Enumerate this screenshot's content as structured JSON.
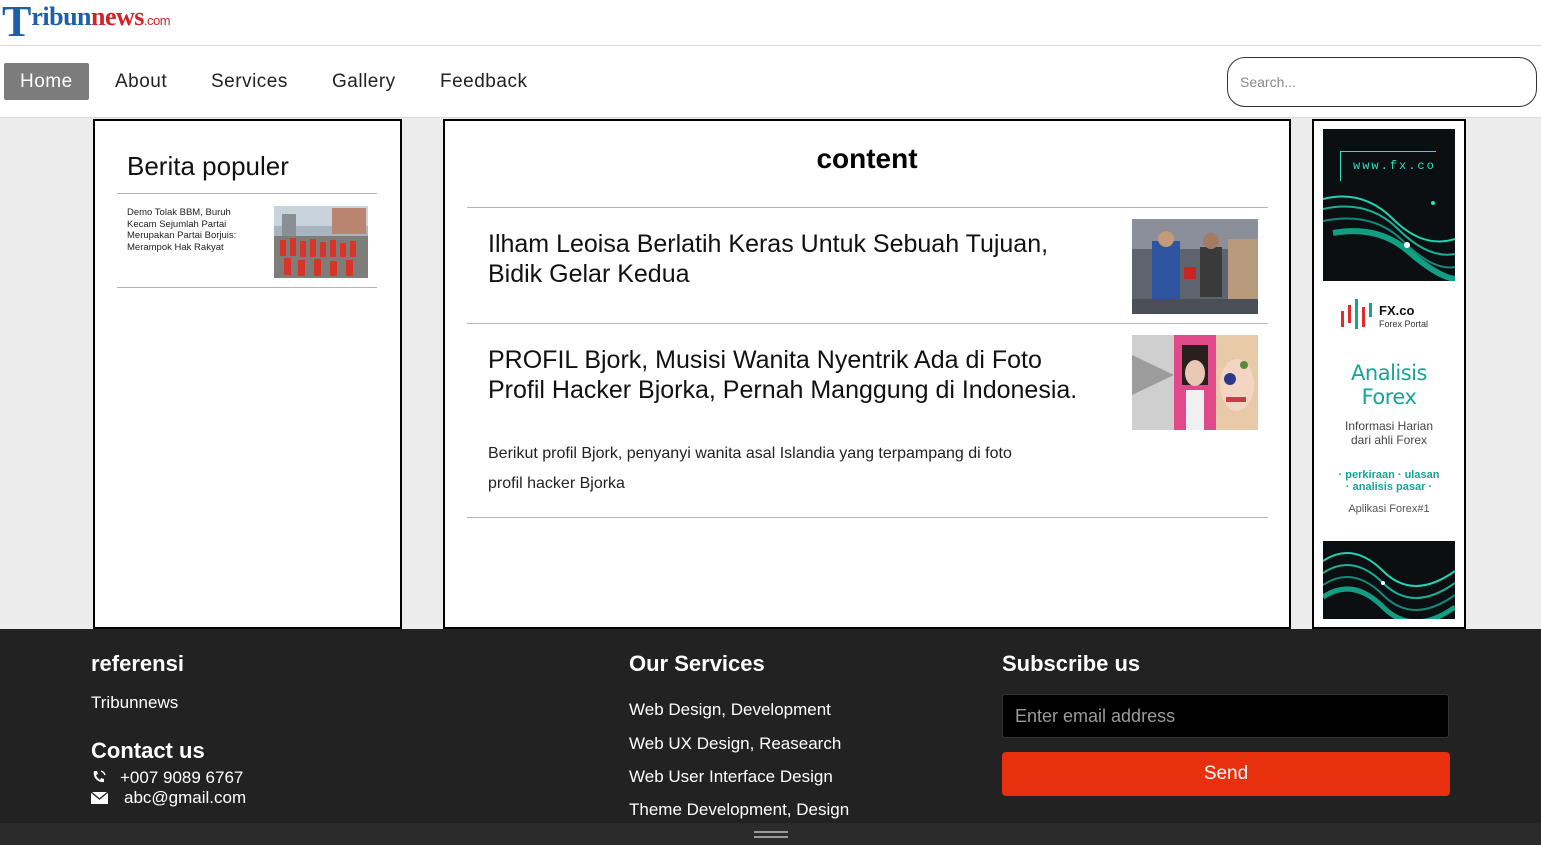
{
  "logo": {
    "t": "T",
    "ribun": "ribun",
    "news": "news",
    "dotcom": ".com"
  },
  "nav": {
    "items": [
      {
        "label": "Home"
      },
      {
        "label": "About"
      },
      {
        "label": "Services"
      },
      {
        "label": "Gallery"
      },
      {
        "label": "Feedback"
      }
    ],
    "search_placeholder": "Search..."
  },
  "popular": {
    "title": "Berita populer",
    "items": [
      {
        "text": "Demo Tolak BBM, Buruh Kecam Sejumlah Partai Merupakan Partai Borjuis: Merampok Hak Rakyat"
      }
    ]
  },
  "content": {
    "title": "content",
    "articles": [
      {
        "title": "Ilham Leoisa Berlatih Keras Untuk Sebuah Tujuan, Bidik Gelar Kedua",
        "desc": ""
      },
      {
        "title": "PROFIL Bjork, Musisi Wanita Nyentrik Ada di Foto Profil Hacker Bjorka, Pernah Manggung di Indonesia.",
        "desc": "Berikut profil Bjork, penyanyi wanita asal Islandia yang terpampang di foto profil hacker Bjorka"
      }
    ]
  },
  "ad": {
    "url": "www.fx.co",
    "brand": "FX.co",
    "brand_sub": "Forex Portal",
    "heading_line1": "Analisis",
    "heading_line2": "Forex",
    "info_line1": "Informasi Harian",
    "info_line2": "dari ahli Forex",
    "points_line1": "· perkiraan · ulasan",
    "points_line2": "· analisis pasar ·",
    "app": "Aplikasi Forex#1",
    "accent": "#2de0c4"
  },
  "footer": {
    "ref_title": "referensi",
    "ref_item": "Tribunnews",
    "contact_title": "Contact us",
    "phone": "+007 9089 6767",
    "email": "abc@gmail.com",
    "services_title": "Our Services",
    "services": [
      "Web Design, Development",
      "Web UX Design, Reasearch",
      "Web User Interface Design",
      "Theme Development, Design"
    ],
    "subscribe_title": "Subscribe us",
    "email_placeholder": "Enter email address",
    "send_label": "Send",
    "send_color": "#e8300f"
  }
}
